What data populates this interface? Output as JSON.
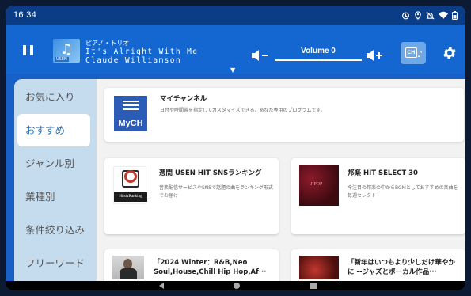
{
  "status": {
    "time": "16:34",
    "icons": [
      "alarm-icon",
      "location-icon",
      "mute-icon",
      "wifi-icon",
      "battery-icon"
    ]
  },
  "player": {
    "thumb_tag": "USEN",
    "category": "ピアノ・トリオ",
    "title": "It's Alright With Me",
    "artist": "Claude Williamson",
    "volume_label": "Volume 0",
    "volume_level": 0
  },
  "sidebar": {
    "items": [
      {
        "label": "お気に入り",
        "active": false
      },
      {
        "label": "おすすめ",
        "active": true
      },
      {
        "label": "ジャンル別",
        "active": false
      },
      {
        "label": "業種別",
        "active": false
      },
      {
        "label": "条件絞り込み",
        "active": false
      },
      {
        "label": "フリーワード",
        "active": false
      }
    ]
  },
  "cards": {
    "mych": {
      "logo_text": "MyCH",
      "title": "マイチャンネル",
      "desc": "日付や時間帯を指定してカスタマイズできる、あなた専用のプログラムです。"
    },
    "hits": {
      "logo_text": "Hits&Ranking",
      "title": "週間 USEN HIT SNSランキング",
      "desc": "音楽配信サービスやSNSで話題の曲をランキング形式でお届け"
    },
    "jpop": {
      "title": "邦楽 HIT SELECT 30",
      "desc": "今注目の邦楽の中からBGMとしておすすめの楽曲を毎週セレクト"
    },
    "winter": {
      "title": "「2024 Winter：R&B,Neo Soul,House,Chill Hip Hop,Af···"
    },
    "newyear": {
      "title": "「新年はいつもより少しだけ華やかに --ジャズとボーカル作品···"
    }
  },
  "colors": {
    "status_bar": "#0b3d86",
    "player": "#1467d0",
    "sidebar": "#c5dcef",
    "active_text": "#2a72b8",
    "mych_logo": "#2b5db8"
  }
}
